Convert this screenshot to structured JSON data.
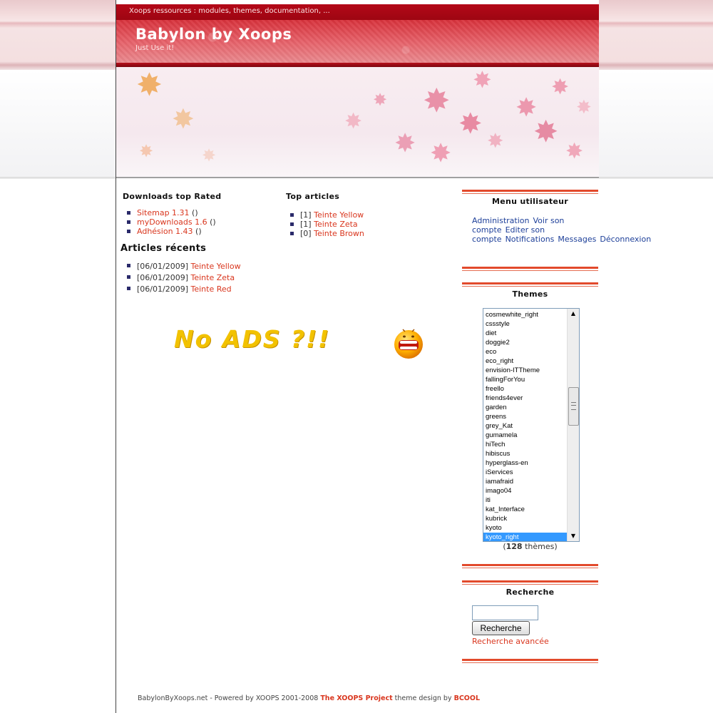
{
  "header": {
    "topbar": "Xoops ressources : modules, themes, documentation, ...",
    "site_title": "Babylon by Xoops",
    "slogan": "Just Use it!"
  },
  "downloads_block": {
    "title": "Downloads top Rated",
    "items": [
      {
        "link": "Sitemap 1.31",
        "suffix": "()"
      },
      {
        "link": "myDownloads 1.6",
        "suffix": "()"
      },
      {
        "link": "Adhésion 1.43",
        "suffix": "()"
      }
    ]
  },
  "top_articles": {
    "title": "Top articles",
    "items": [
      {
        "count": "[1]",
        "link": "Teinte Yellow"
      },
      {
        "count": "[1]",
        "link": "Teinte Zeta"
      },
      {
        "count": "[0]",
        "link": "Teinte Brown"
      }
    ]
  },
  "recent_articles": {
    "title": "Articles récents",
    "items": [
      {
        "date": "[06/01/2009]",
        "link": "Teinte Yellow"
      },
      {
        "date": "[06/01/2009]",
        "link": "Teinte Zeta"
      },
      {
        "date": "[06/01/2009]",
        "link": "Teinte Red"
      }
    ]
  },
  "ad_banner": {
    "text": "No ADS ?!!"
  },
  "user_menu": {
    "title": "Menu utilisateur",
    "links": [
      "Administration",
      "Voir son compte",
      "Editer son compte",
      "Notifications",
      "Messages",
      "Déconnexion"
    ]
  },
  "themes_block": {
    "title": "Themes",
    "options": [
      "cosmewhite_right",
      "cssstyle",
      "diet",
      "doggie2",
      "eco",
      "eco_right",
      "envision-ITTheme",
      "fallingForYou",
      "freello",
      "friends4ever",
      "garden",
      "greens",
      "grey_Kat",
      "gumamela",
      "hiTech",
      "hibiscus",
      "hyperglass-en",
      "iServices",
      "iamafraid",
      "imago04",
      "iti",
      "kat_Interface",
      "kubrick",
      "kyoto",
      "kyoto_right"
    ],
    "selected": "kyoto_right",
    "count_open": "(",
    "count": "128",
    "count_suffix": "thèmes)"
  },
  "search_block": {
    "title": "Recherche",
    "input_value": "",
    "button": "Recherche",
    "advanced": "Recherche avancée"
  },
  "footer": {
    "text": "BabylonByXoops.net - Powered by XOOPS 2001-2008",
    "xoops_link": "The XOOPS Project",
    "design_text": "theme design by",
    "designer_link": "BCOOL"
  },
  "colors": {
    "link": "#d9361e",
    "user_menu_link": "#1d3f99",
    "topbar": "#b40818",
    "sidebar_rule": "#e24a2c"
  }
}
